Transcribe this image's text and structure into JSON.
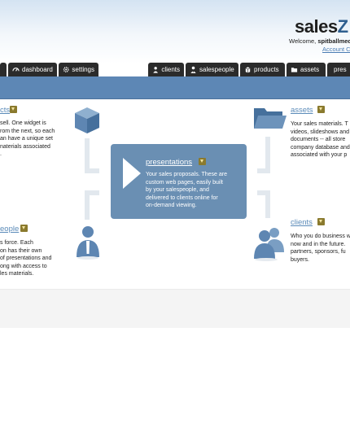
{
  "header": {
    "logo_part1": "sales",
    "logo_part2": "Z",
    "welcome_prefix": "Welcome,",
    "username": "spitballmed",
    "account_link": "Account C"
  },
  "tabs_left": [
    {
      "label": "",
      "icon": "arrow-icon"
    },
    {
      "label": "dashboard",
      "icon": "dashboard-gauge-icon"
    },
    {
      "label": "settings",
      "icon": "gear-icon"
    }
  ],
  "tabs_right": [
    {
      "label": "clients",
      "icon": "person-icon"
    },
    {
      "label": "salespeople",
      "icon": "person-tie-icon"
    },
    {
      "label": "products",
      "icon": "box-icon"
    },
    {
      "label": "assets",
      "icon": "folder-icon"
    },
    {
      "label": "pres",
      "icon": "play-icon"
    }
  ],
  "sections": {
    "products": {
      "title": "cts",
      "lines": [
        "sell. One widget is",
        "rom the next, so each",
        "an have a unique set",
        "naterials associated",
        "."
      ]
    },
    "assets": {
      "title": "assets",
      "lines": [
        "Your sales materials. T",
        "videos, slideshows and",
        "documents -- all store",
        "company database and",
        "associated with your p"
      ]
    },
    "presentations": {
      "title": "presentations",
      "lines": [
        "Your sales proposals. These are",
        "custom web pages, easily built",
        "by your salespeople, and",
        "delivered to clients online for",
        "on-demand viewing."
      ]
    },
    "salespeople": {
      "title": "eople",
      "lines": [
        "s force. Each",
        "on has their own",
        "of presentations and",
        "ong with access to",
        "les materials."
      ]
    },
    "clients": {
      "title": "clients",
      "lines": [
        "Who you do business w",
        "now and in the future.",
        "partners, sponsors, fu",
        "buyers."
      ]
    }
  },
  "colors": {
    "navbar": "#5d87b5",
    "tab_bg": "#2b2b2b",
    "accent_link": "#5b8bb9",
    "center_box": "#6a8fb3",
    "icon_blue": "#5e86b2"
  }
}
